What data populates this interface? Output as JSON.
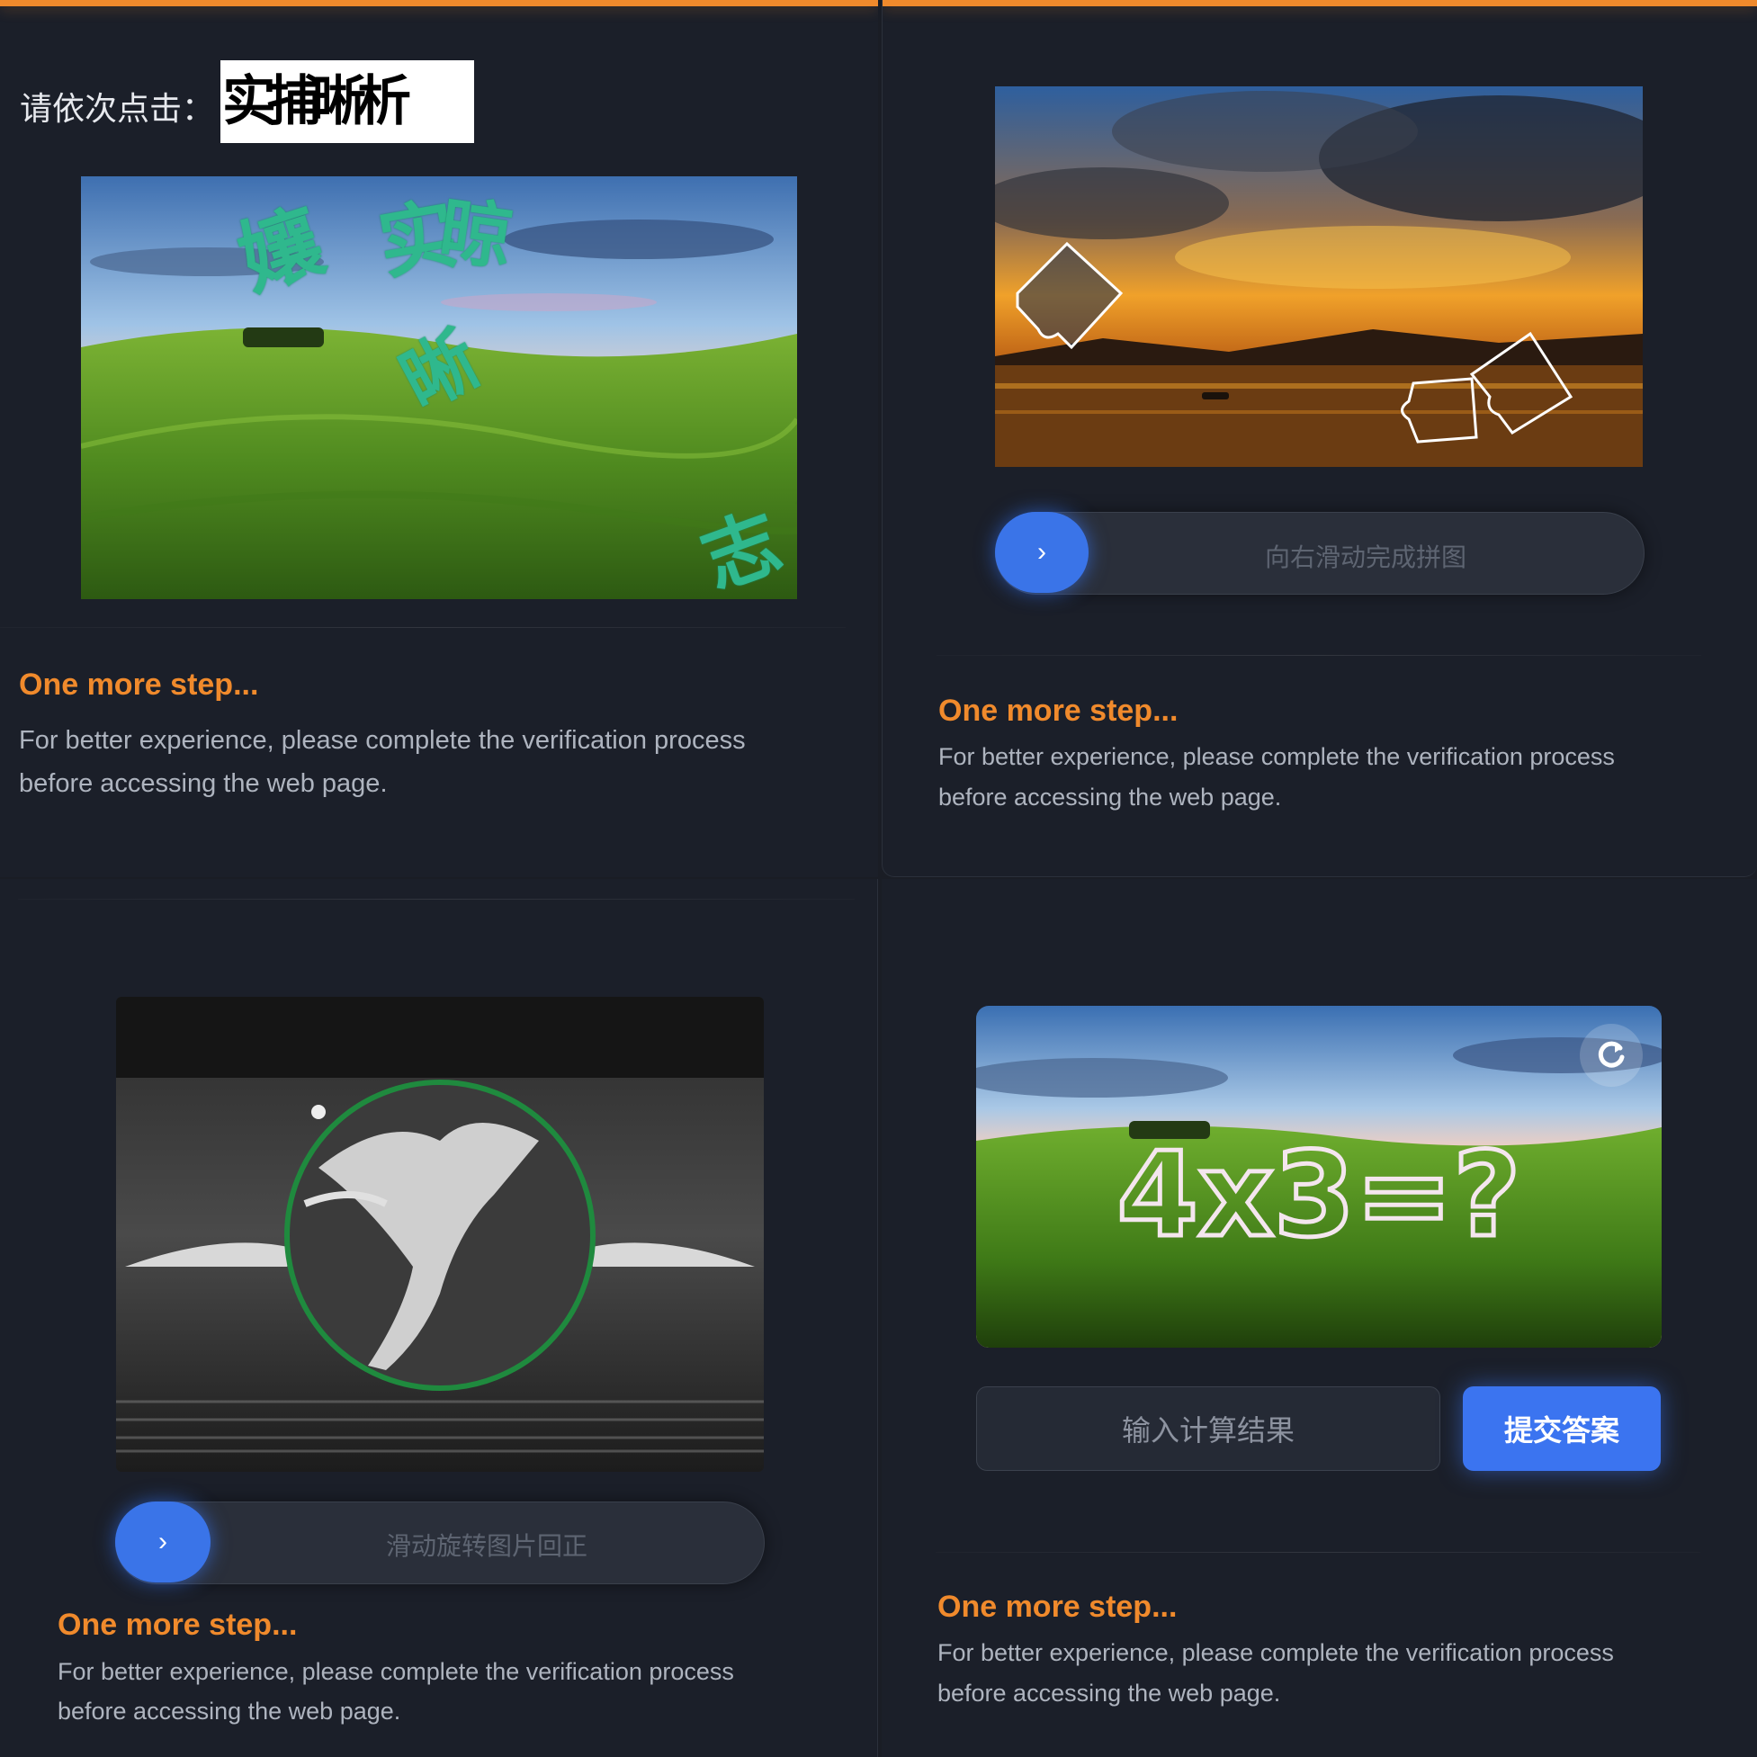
{
  "click_captcha": {
    "prompt_label": "请依次点击：",
    "target_chars": "实捕晰析",
    "scattered_chars": [
      "孃",
      "实",
      "晾",
      "晰",
      "志"
    ]
  },
  "slide_captcha": {
    "hint": "向右滑动完成拼图",
    "knob_glyph": "›"
  },
  "rotate_captcha": {
    "hint": "滑动旋转图片回正",
    "knob_glyph": "›"
  },
  "math_captcha": {
    "expression": "4x3=?",
    "refresh_icon": "refresh-icon",
    "input_placeholder": "输入计算结果",
    "submit_label": "提交答案"
  },
  "notice": {
    "title": "One more step...",
    "line1": "For better experience, please complete the verification process",
    "line2": "before accessing the web page."
  },
  "colors": {
    "accent_orange": "#f08a2c",
    "button_blue": "#3b74f0",
    "background": "#1b1f29"
  }
}
